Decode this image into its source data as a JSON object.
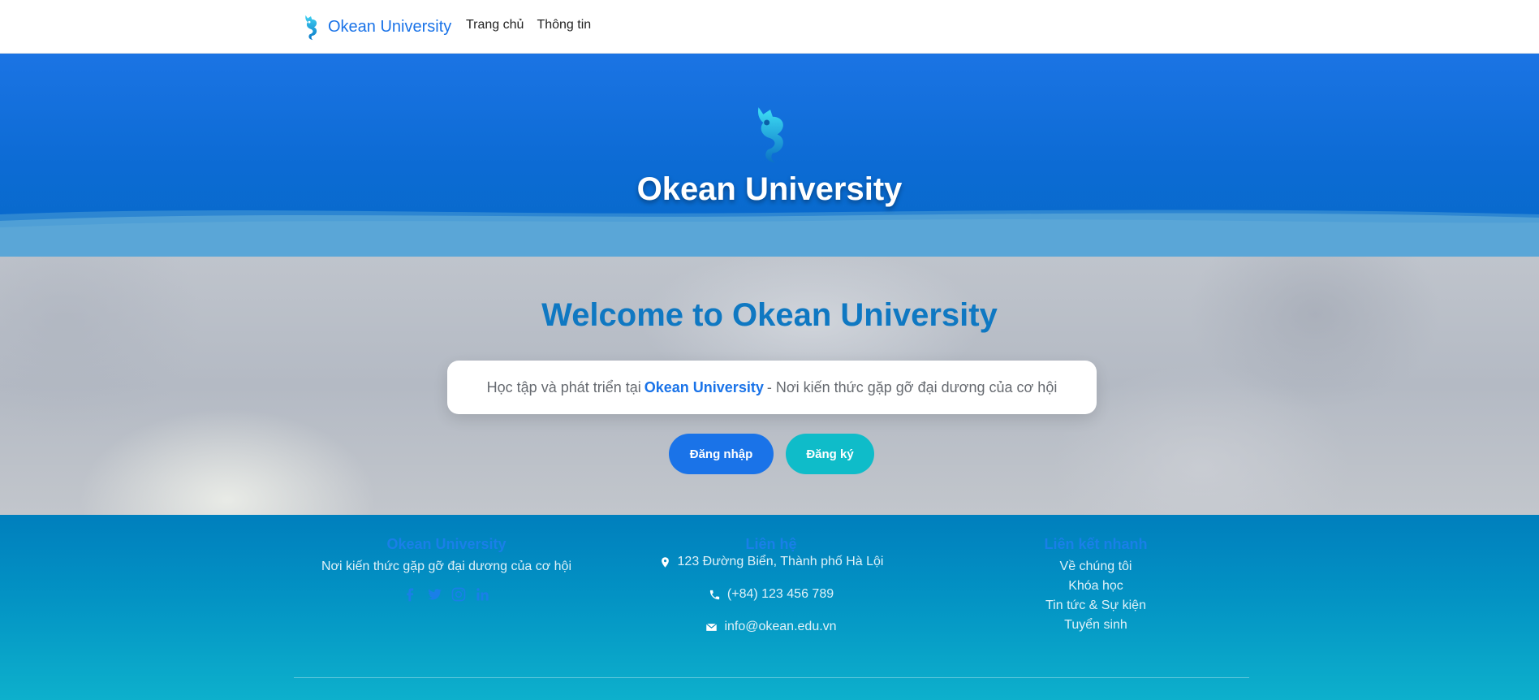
{
  "navbar": {
    "brand": "Okean University",
    "links": [
      "Trang chủ",
      "Thông tin"
    ]
  },
  "hero": {
    "title": "Okean University"
  },
  "welcome": {
    "heading": "Welcome to Okean University",
    "tagline_before": "Học tập và phát triển tại",
    "tagline_highlight": "Okean University",
    "tagline_after": "- Nơi kiến thức gặp gỡ đại dương của cơ hội",
    "login_label": "Đăng nhập",
    "register_label": "Đăng ký"
  },
  "footer": {
    "about": {
      "title": "Okean University",
      "text": "Nơi kiến thức gặp gỡ đại dương của cơ hội",
      "social_icons": [
        "facebook-icon",
        "twitter-icon",
        "instagram-icon",
        "linkedin-icon"
      ]
    },
    "contact": {
      "title": "Liên hệ",
      "address": "123 Đường Biển, Thành phố Hà Lội",
      "phone": "(+84) 123 456 789",
      "email": "info@okean.edu.vn"
    },
    "quick_links": {
      "title": "Liên kết nhanh",
      "items": [
        "Về chúng tôi",
        "Khóa học",
        "Tin tức & Sự kiện",
        "Tuyển sinh"
      ]
    }
  },
  "colors": {
    "primary": "#1a73e8",
    "accent": "#0fbcc9",
    "heading": "#0f78c2",
    "footer_top": "#007fbd",
    "footer_bottom": "#0db0cc"
  }
}
